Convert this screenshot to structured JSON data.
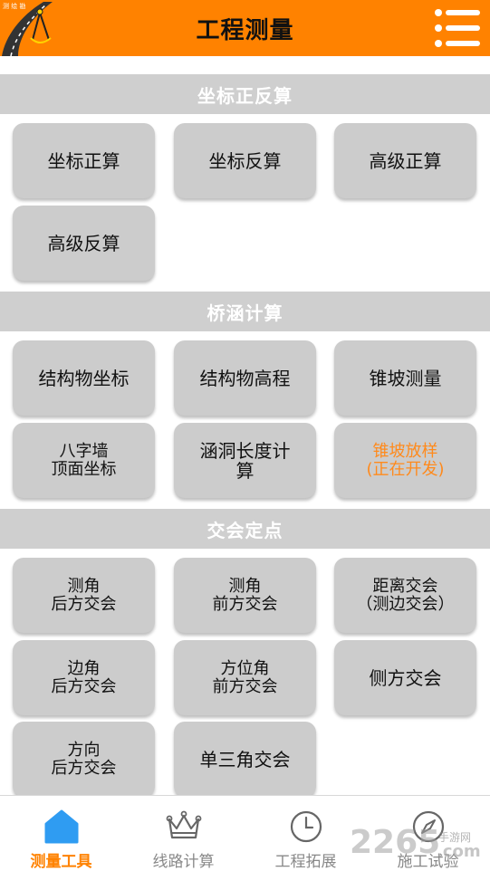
{
  "header": {
    "title": "工程测量",
    "logo_text": "测 绘 勘",
    "logo_icon": "road-compass-icon",
    "menu_icon": "list-menu-icon",
    "accent_color": "#ff8200"
  },
  "sections": [
    {
      "title": "坐标正反算",
      "buttons": [
        "坐标正算",
        "坐标反算",
        "高级正算",
        "高级反算"
      ]
    },
    {
      "title": "桥涵计算",
      "buttons": [
        "结构物坐标",
        "结构物高程",
        "锥坡测量",
        "八字墙\n顶面坐标",
        "涵洞长度计\n算",
        "锥坡放样\n(正在开发)"
      ]
    },
    {
      "title": "交会定点",
      "buttons": [
        "测角\n后方交会",
        "测角\n前方交会",
        "距离交会\n（测边交会）",
        "边角\n后方交会",
        "方位角\n前方交会",
        "侧方交会",
        "方向\n后方交会",
        "单三角交会"
      ]
    }
  ],
  "bottom_nav": [
    {
      "label": "测量工具",
      "icon": "home-icon",
      "active": true
    },
    {
      "label": "线路计算",
      "icon": "crown-icon",
      "active": false
    },
    {
      "label": "工程拓展",
      "icon": "clock-icon",
      "active": false
    },
    {
      "label": "施工试验",
      "icon": "compass-icon",
      "active": false
    }
  ],
  "watermark": {
    "number": "2265",
    "small": "手游网",
    "domain": ".com"
  },
  "colors": {
    "section_bg": "#cfcfcf",
    "button_bg": "#cccccc",
    "dev_text": "#ff8a1c",
    "nav_inactive": "#888888"
  }
}
